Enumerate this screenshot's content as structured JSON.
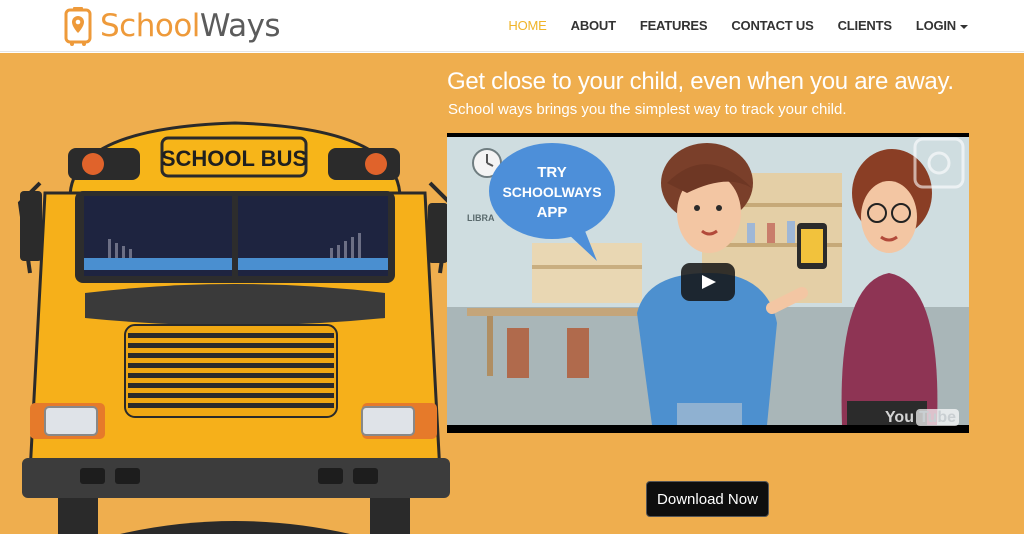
{
  "brand": {
    "name_part1": "School",
    "name_part2": "Ways",
    "logo_icon": "map-pin-phone-icon"
  },
  "nav": {
    "items": [
      {
        "label": "HOME",
        "active": true
      },
      {
        "label": "ABOUT"
      },
      {
        "label": "FEATURES"
      },
      {
        "label": "CONTACT US"
      },
      {
        "label": "CLIENTS"
      },
      {
        "label": "LOGIN",
        "dropdown": true
      }
    ]
  },
  "hero": {
    "title": "Get close to your child, even when you are away.",
    "subtitle": "School ways brings you the simplest way to track your child.",
    "bus_sign": "SCHOOL BUS",
    "video": {
      "bubble_lines": [
        "TRY",
        "SCHOOLWAYS",
        "APP"
      ],
      "wall_text": "LIBRA",
      "provider": "You",
      "provider_badge": "Tube"
    },
    "download_label": "Download Now"
  },
  "colors": {
    "accent": "#efae4e",
    "nav_active": "#f0b429",
    "brand_orange": "#ee9a3a"
  }
}
